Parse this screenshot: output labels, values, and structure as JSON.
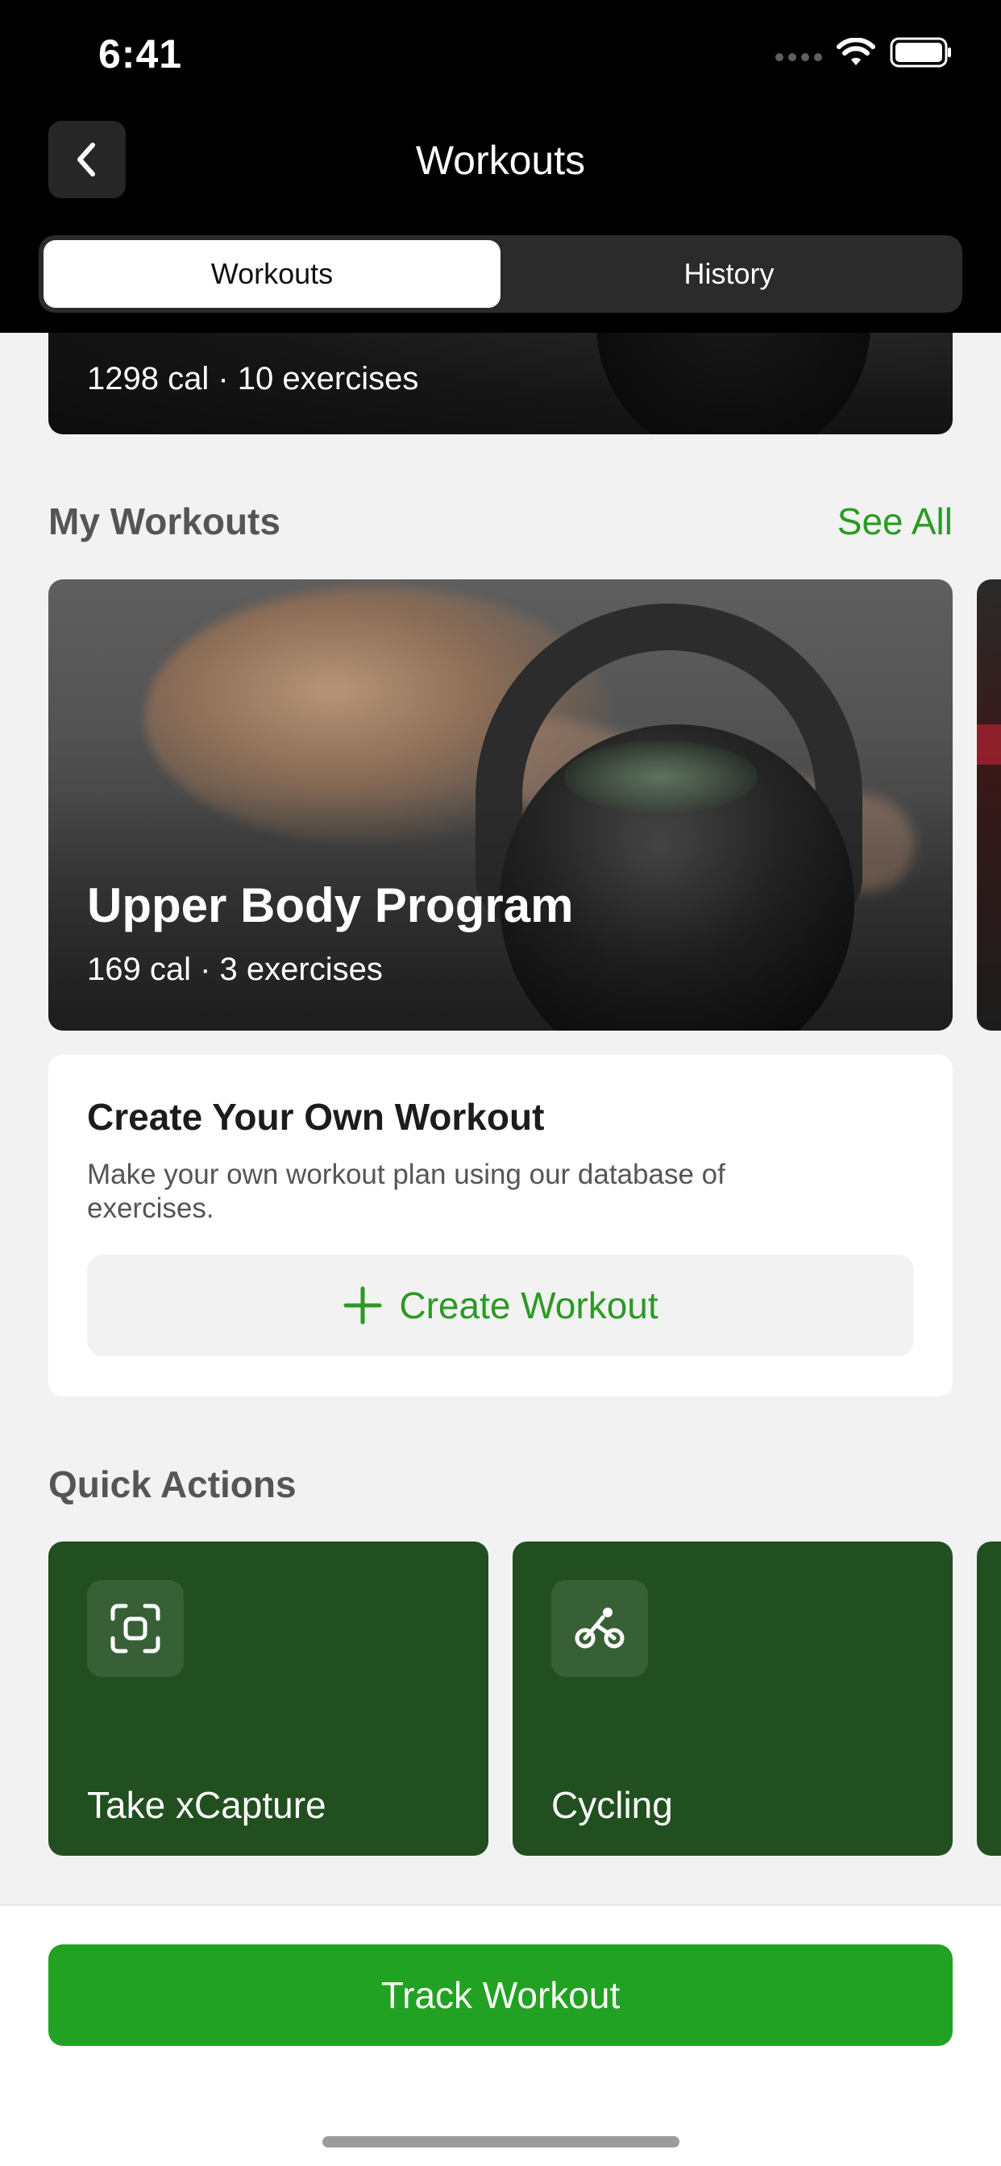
{
  "status_bar": {
    "time": "6:41",
    "icons": [
      "signal-icon",
      "wifi-icon",
      "battery-icon"
    ]
  },
  "nav": {
    "title": "Workouts",
    "back_icon": "chevron-left-icon"
  },
  "segments": [
    {
      "label": "Workouts",
      "active": true
    },
    {
      "label": "History",
      "active": false
    }
  ],
  "top_card": {
    "meta": "1298 cal · 10 exercises"
  },
  "my_workouts": {
    "title": "My Workouts",
    "see_all": "See All",
    "program": {
      "title": "Upper Body Program",
      "meta": "169 cal · 3 exercises"
    }
  },
  "create_workout": {
    "title": "Create Your Own Workout",
    "description": "Make your own workout plan using our database of exercises.",
    "button_label": "Create Workout",
    "button_icon": "plus-icon"
  },
  "quick_actions": {
    "title": "Quick Actions",
    "items": [
      {
        "label": "Take xCapture",
        "icon": "scan-icon"
      },
      {
        "label": "Cycling",
        "icon": "bicycle-icon"
      }
    ]
  },
  "bottom": {
    "track_label": "Track Workout"
  },
  "colors": {
    "accent_green": "#2a9a23",
    "button_green": "#22a222",
    "card_dark_green": "#224f20",
    "header_black": "#000000"
  }
}
